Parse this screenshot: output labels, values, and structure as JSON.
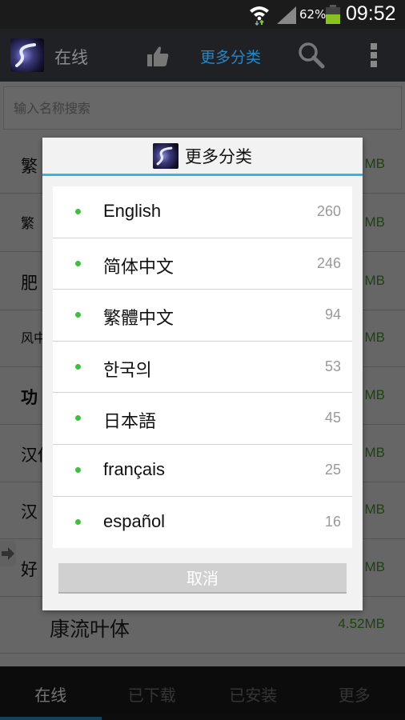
{
  "status_bar": {
    "battery_percent": "62%",
    "time": "09:52",
    "battery_color": "#8ac31f"
  },
  "action_bar": {
    "title": "在线",
    "current_section": "更多分类",
    "accent_color": "#2a85c4"
  },
  "search": {
    "placeholder": "输入名称搜索"
  },
  "font_list": [
    {
      "name": "繁",
      "size": "MB"
    },
    {
      "name": "繁",
      "size": "MB"
    },
    {
      "name": "肥",
      "size": "MB"
    },
    {
      "name": "风中",
      "size": "MB"
    },
    {
      "name": "功",
      "size": "MB"
    },
    {
      "name": "汉仪",
      "size": "MB"
    },
    {
      "name": "汉",
      "size": "MB"
    },
    {
      "name": "好",
      "size": "MB"
    },
    {
      "name": "康流叶体",
      "size": "4.52MB"
    }
  ],
  "dialog": {
    "title": "更多分类",
    "languages": [
      {
        "name": "English",
        "count": "260"
      },
      {
        "name": "简体中文",
        "count": "246"
      },
      {
        "name": "繁體中文",
        "count": "94"
      },
      {
        "name": "한국의",
        "count": "53"
      },
      {
        "name": "日本語",
        "count": "45"
      },
      {
        "name": "français",
        "count": "25"
      },
      {
        "name": "español",
        "count": "16"
      }
    ],
    "cancel_label": "取消",
    "divider_color": "#33b5e5"
  },
  "bottom_tabs": [
    {
      "label": "在线",
      "active": true
    },
    {
      "label": "已下载",
      "active": false
    },
    {
      "label": "已安装",
      "active": false
    },
    {
      "label": "更多",
      "active": false
    }
  ]
}
